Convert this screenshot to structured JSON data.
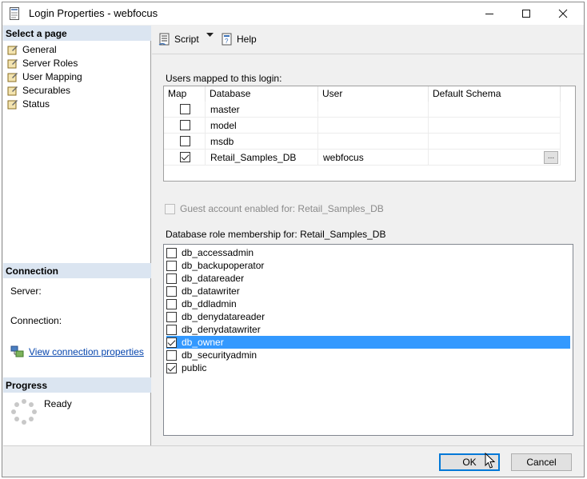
{
  "window": {
    "title": "Login Properties - webfocus"
  },
  "left": {
    "select_page_header": "Select a page",
    "pages": [
      {
        "label": "General",
        "selected": false
      },
      {
        "label": "Server Roles",
        "selected": false
      },
      {
        "label": "User Mapping",
        "selected": true
      },
      {
        "label": "Securables",
        "selected": false
      },
      {
        "label": "Status",
        "selected": false
      }
    ],
    "connection_header": "Connection",
    "server_label": "Server:",
    "connection_label": "Connection:",
    "view_connection_link": "View connection properties",
    "progress_header": "Progress",
    "progress_status": "Ready"
  },
  "toolbar": {
    "script_label": "Script",
    "help_label": "Help"
  },
  "users": {
    "label": "Users mapped to this login:",
    "columns": [
      "Map",
      "Database",
      "User",
      "Default Schema"
    ],
    "rows": [
      {
        "checked": false,
        "database": "master",
        "user": "",
        "schema": ""
      },
      {
        "checked": false,
        "database": "model",
        "user": "",
        "schema": ""
      },
      {
        "checked": false,
        "database": "msdb",
        "user": "",
        "schema": ""
      },
      {
        "checked": true,
        "database": "Retail_Samples_DB",
        "user": "webfocus",
        "schema": "",
        "ellipsis": "..."
      }
    ]
  },
  "guest": {
    "label": "Guest account enabled for: Retail_Samples_DB",
    "checked": false,
    "enabled": false
  },
  "roles": {
    "label": "Database role membership for: Retail_Samples_DB",
    "items": [
      {
        "label": "db_accessadmin",
        "checked": false,
        "selected": false
      },
      {
        "label": "db_backupoperator",
        "checked": false,
        "selected": false
      },
      {
        "label": "db_datareader",
        "checked": false,
        "selected": false
      },
      {
        "label": "db_datawriter",
        "checked": false,
        "selected": false
      },
      {
        "label": "db_ddladmin",
        "checked": false,
        "selected": false
      },
      {
        "label": "db_denydatareader",
        "checked": false,
        "selected": false
      },
      {
        "label": "db_denydatawriter",
        "checked": false,
        "selected": false
      },
      {
        "label": "db_owner",
        "checked": true,
        "selected": true
      },
      {
        "label": "db_securityadmin",
        "checked": false,
        "selected": false
      },
      {
        "label": "public",
        "checked": true,
        "selected": false
      }
    ]
  },
  "buttons": {
    "ok_label": "OK",
    "cancel_label": "Cancel"
  }
}
